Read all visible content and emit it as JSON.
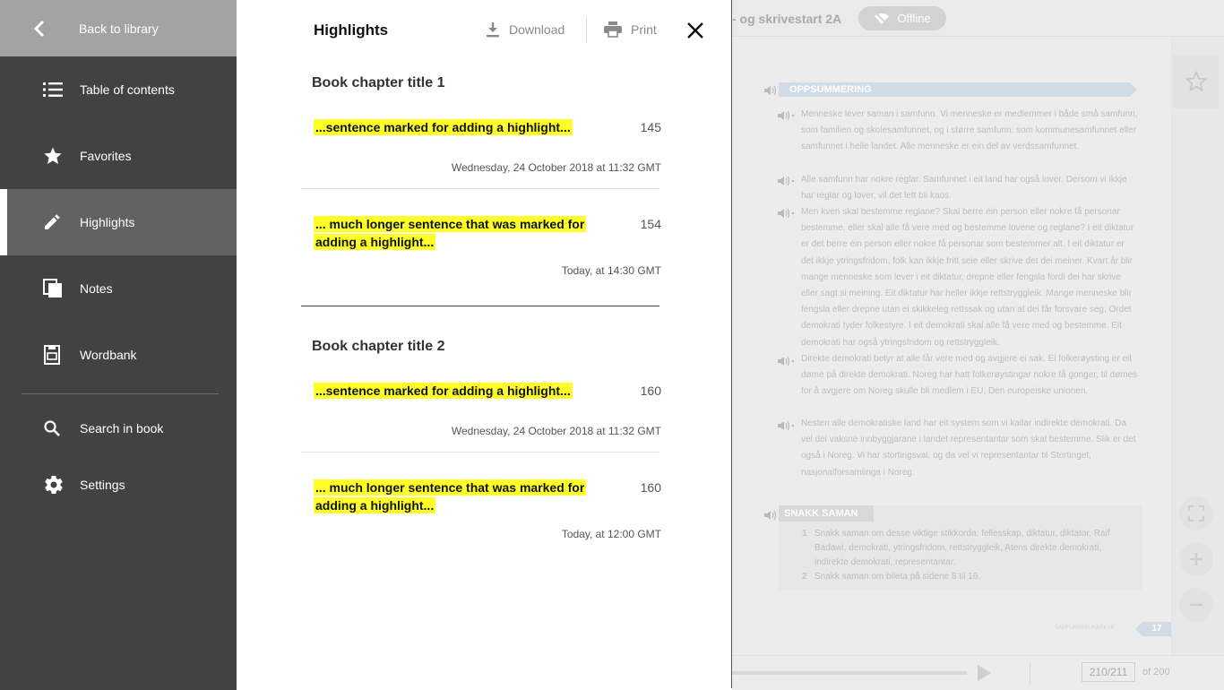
{
  "sidebar": {
    "back_label": "Back to library",
    "items": [
      {
        "label": "Table of contents",
        "icon": "list-icon"
      },
      {
        "label": "Favorites",
        "icon": "star-icon"
      },
      {
        "label": "Highlights",
        "icon": "pencil-icon",
        "active": true
      },
      {
        "label": "Notes",
        "icon": "notes-icon"
      },
      {
        "label": "Wordbank",
        "icon": "wordbank-icon"
      }
    ],
    "tools": [
      {
        "label": "Search in book",
        "icon": "search-icon"
      },
      {
        "label": "Settings",
        "icon": "gear-icon"
      }
    ]
  },
  "panel": {
    "title": "Highlights",
    "download_label": "Download",
    "print_label": "Print",
    "chapters": [
      {
        "title": "Book chapter title 1",
        "entries": [
          {
            "text": "...sentence marked for adding a highlight...",
            "page": "145",
            "date": "Wednesday, 24 October 2018 at 11:32 GMT"
          },
          {
            "text": "... much longer sentence that was marked for adding a highlight...",
            "page": "154",
            "date": "Today, at 14:30 GMT"
          }
        ]
      },
      {
        "title": "Book chapter title 2",
        "entries": [
          {
            "text": "...sentence marked for adding a highlight...",
            "page": "160",
            "date": "Wednesday, 24 October 2018 at 11:32 GMT"
          },
          {
            "text": "... much longer sentence that was marked for adding a highlight...",
            "page": "160",
            "date": "Today, at 12:00 GMT"
          }
        ]
      }
    ]
  },
  "reader": {
    "book_title": "- og skrivestart 2A",
    "offline_label": "Offline",
    "section_title": "OPPSUMMERING",
    "paragraphs": [
      "Menneske lever saman i samfunn. Vi menneske er medlemmer i både små samfunn, som familien og skolesamfunnet, og i større samfunn, som kommunesamfunnet eller samfunnet i heile landet. Alle menneske er ein del av verdssamfunnet.",
      "Alle samfunn har nokre reglar. Samfunnet i eit land har også lover. Dersom vi ikkje har reglar og lover, vil det lett bli kaos.",
      "Men kven skal bestemme reglane? Skal berre éin person eller nokre få personar bestemme, eller skal alle få vere med og bestemme lovene og reglane? I eit diktatur er det berre éin person eller nokre få personar som bestemmer alt. I eit diktatur er det ikkje ytringsfridom, folk kan ikkje fritt seie eller skrive det dei meiner. Kvart år blir mange menneske som lever i eit diktatur, drepne eller fengsla fordi dei har skrive eller sagt si meining. Eit diktatur har heller ikkje rettstryggleik. Mange menneske blir fengsla eller drepne utan ei skikkeleg rettssak og utan at dei får forsvare seg. Ordet demokrati tyder folkestyre. I eit demokrati skal alle få vere med og bestemme. Eit demokrati har også ytringsfridom og rettstryggleik.",
      "Direkte demokrati betyr at alle får vere med og avgjere ei sak. Ei folkerøysting er eit døme på direkte demokrati. Noreg har hatt folkerøystingar nokre få gonger, til dømes for å avgjere om Noreg skulle bli medlem i EU, Den europeiske unionen.",
      "Nesten alle demokratiske land har eit system som vi kallar indirekte demokrati. Da vel dei vaksne innbyggjarane i landet representantar som skal bestemme. Slik er det også i Noreg. Vi har stortingsval, og da vel vi representantar til Stortinget, nasjonalforsamlinga i Noreg."
    ],
    "snakk_title": "SNAKK SAMAN",
    "snakk_items": [
      {
        "num": "1",
        "text": "Snakk saman om desse viktige stikkorda: fellesskap, diktatur, diktator, Raif Badawi, demokrati, ytringsfridom, rettstryggleik, Atens direkte demokrati, indirekte demokrati, representantar."
      },
      {
        "num": "2",
        "text": "Snakk saman om bileta på sidene 8 til 16."
      }
    ],
    "page_label": "SAMFUNNSKUNNSKAP",
    "page_badge": "17",
    "page_input": "210/211",
    "page_total": "of 200"
  }
}
